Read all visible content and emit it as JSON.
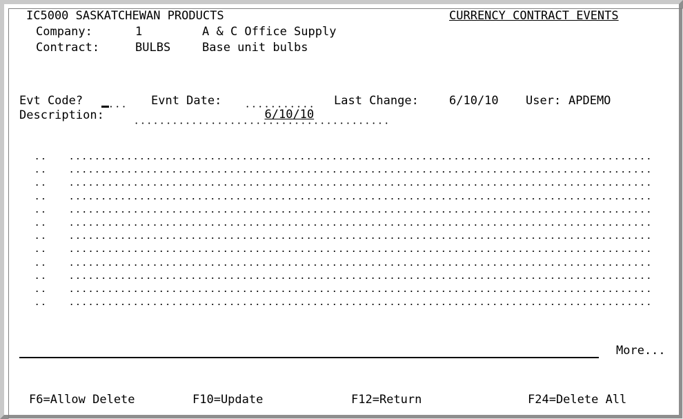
{
  "header": {
    "program": "IC5000 SASKATCHEWAN PRODUCTS",
    "screen_title": "CURRENCY CONTRACT EVENTS",
    "company_label": "Company:",
    "company_value": "1",
    "company_name": "A & C Office Supply",
    "contract_label": "Contract:",
    "contract_value": "BULBS",
    "contract_description": "Base unit bulbs"
  },
  "form": {
    "evt_code_label": "Evt Code?",
    "evt_code_value": "",
    "evnt_date_label": "Evnt Date:",
    "evnt_date_value": "6/10/10",
    "last_change_label": "Last Change:",
    "last_change_value": "6/10/10",
    "user_label": "User:",
    "user_value": "APDEMO",
    "description_label": "Description:",
    "description_value": ""
  },
  "event_lines": [
    {
      "seq": "",
      "text": ""
    },
    {
      "seq": "",
      "text": ""
    },
    {
      "seq": "",
      "text": ""
    },
    {
      "seq": "",
      "text": ""
    },
    {
      "seq": "",
      "text": ""
    },
    {
      "seq": "",
      "text": ""
    },
    {
      "seq": "",
      "text": ""
    },
    {
      "seq": "",
      "text": ""
    },
    {
      "seq": "",
      "text": ""
    },
    {
      "seq": "",
      "text": ""
    },
    {
      "seq": "",
      "text": ""
    },
    {
      "seq": "",
      "text": ""
    }
  ],
  "more_indicator": "More...",
  "function_keys": {
    "f6": "F6=Allow Delete",
    "f10": "F10=Update",
    "f12": "F12=Return",
    "f24": "F24=Delete All"
  }
}
